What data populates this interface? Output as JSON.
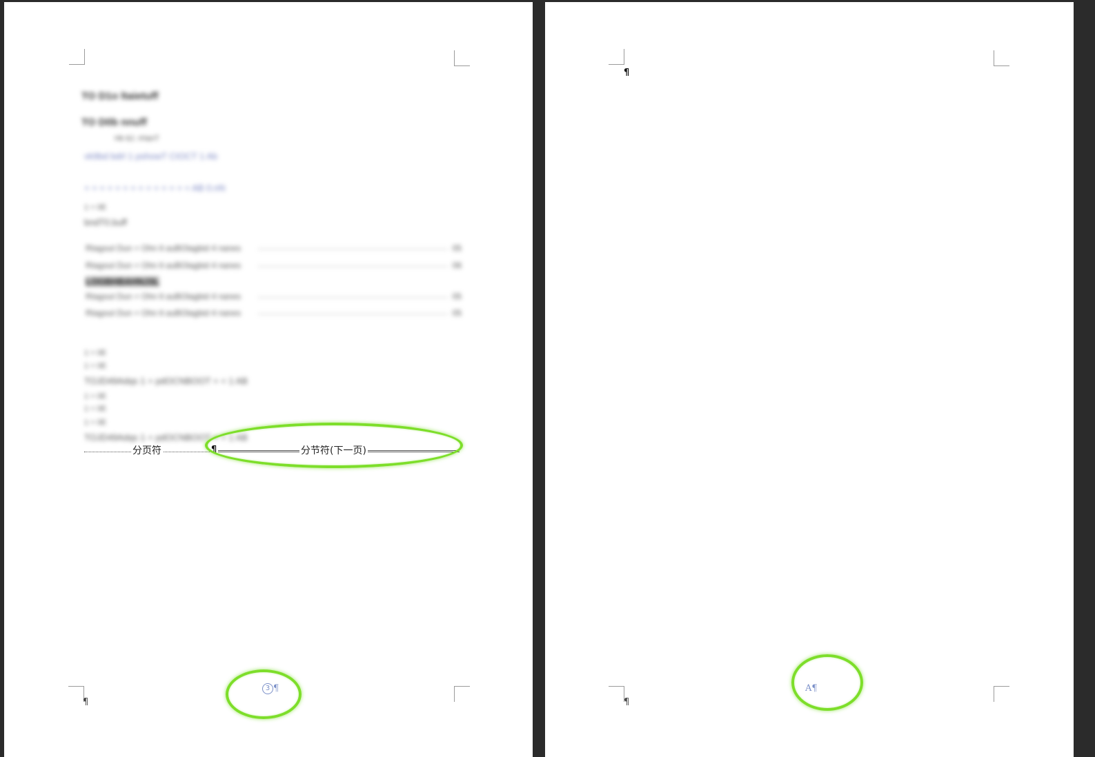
{
  "left_page": {
    "page_break_label": "分页符",
    "section_break_label": "分节符(下一页)",
    "footer_page_number": "3",
    "pilcrow": "¶",
    "blurred_lines": [
      "TO D1o ltaietuff",
      "TO D0b nnuff",
      "Hk ttJ. rHanT",
      "vk9bd bdrl 1 pshowT CIOCT 1 Ab",
      "+ + + + + + + + + + + + + + AB 0.nN",
      "1 + 0E",
      "bndT0.buff",
      "1 + 0E",
      "1 + 0E",
      "TOJD49Adqs 1 + pdOCNBOOT + + 1 AB",
      "1 + 0E",
      "1 + 0E",
      "1 + 0E",
      "TOJD49Adqs 1 + pdOCNBOOT + + 1 AB"
    ],
    "toc_rows": [
      {
        "text": "Rtagout Dun + Ohn lt auBOlagbid 4 nanes",
        "num": "05"
      },
      {
        "text": "Rtagout Dun + Ohn lt auBOlagbid 4 nanes",
        "num": "06"
      },
      {
        "text": "Rtagout Dun + Ohn lt auBOlagbid 4 nanes",
        "num": "05"
      },
      {
        "text": "Rtagout Dun + Ohn lt auBOlagbid 4 nanes",
        "num": "05"
      }
    ],
    "blurred_bold_line": "LOGBHBAHNJ3L"
  },
  "right_page": {
    "footer_mark": "A",
    "pilcrow": "¶"
  },
  "colors": {
    "highlight": "#7dde2a",
    "footer_text": "#7a8fc8",
    "window_bg": "#2b2b2b"
  }
}
